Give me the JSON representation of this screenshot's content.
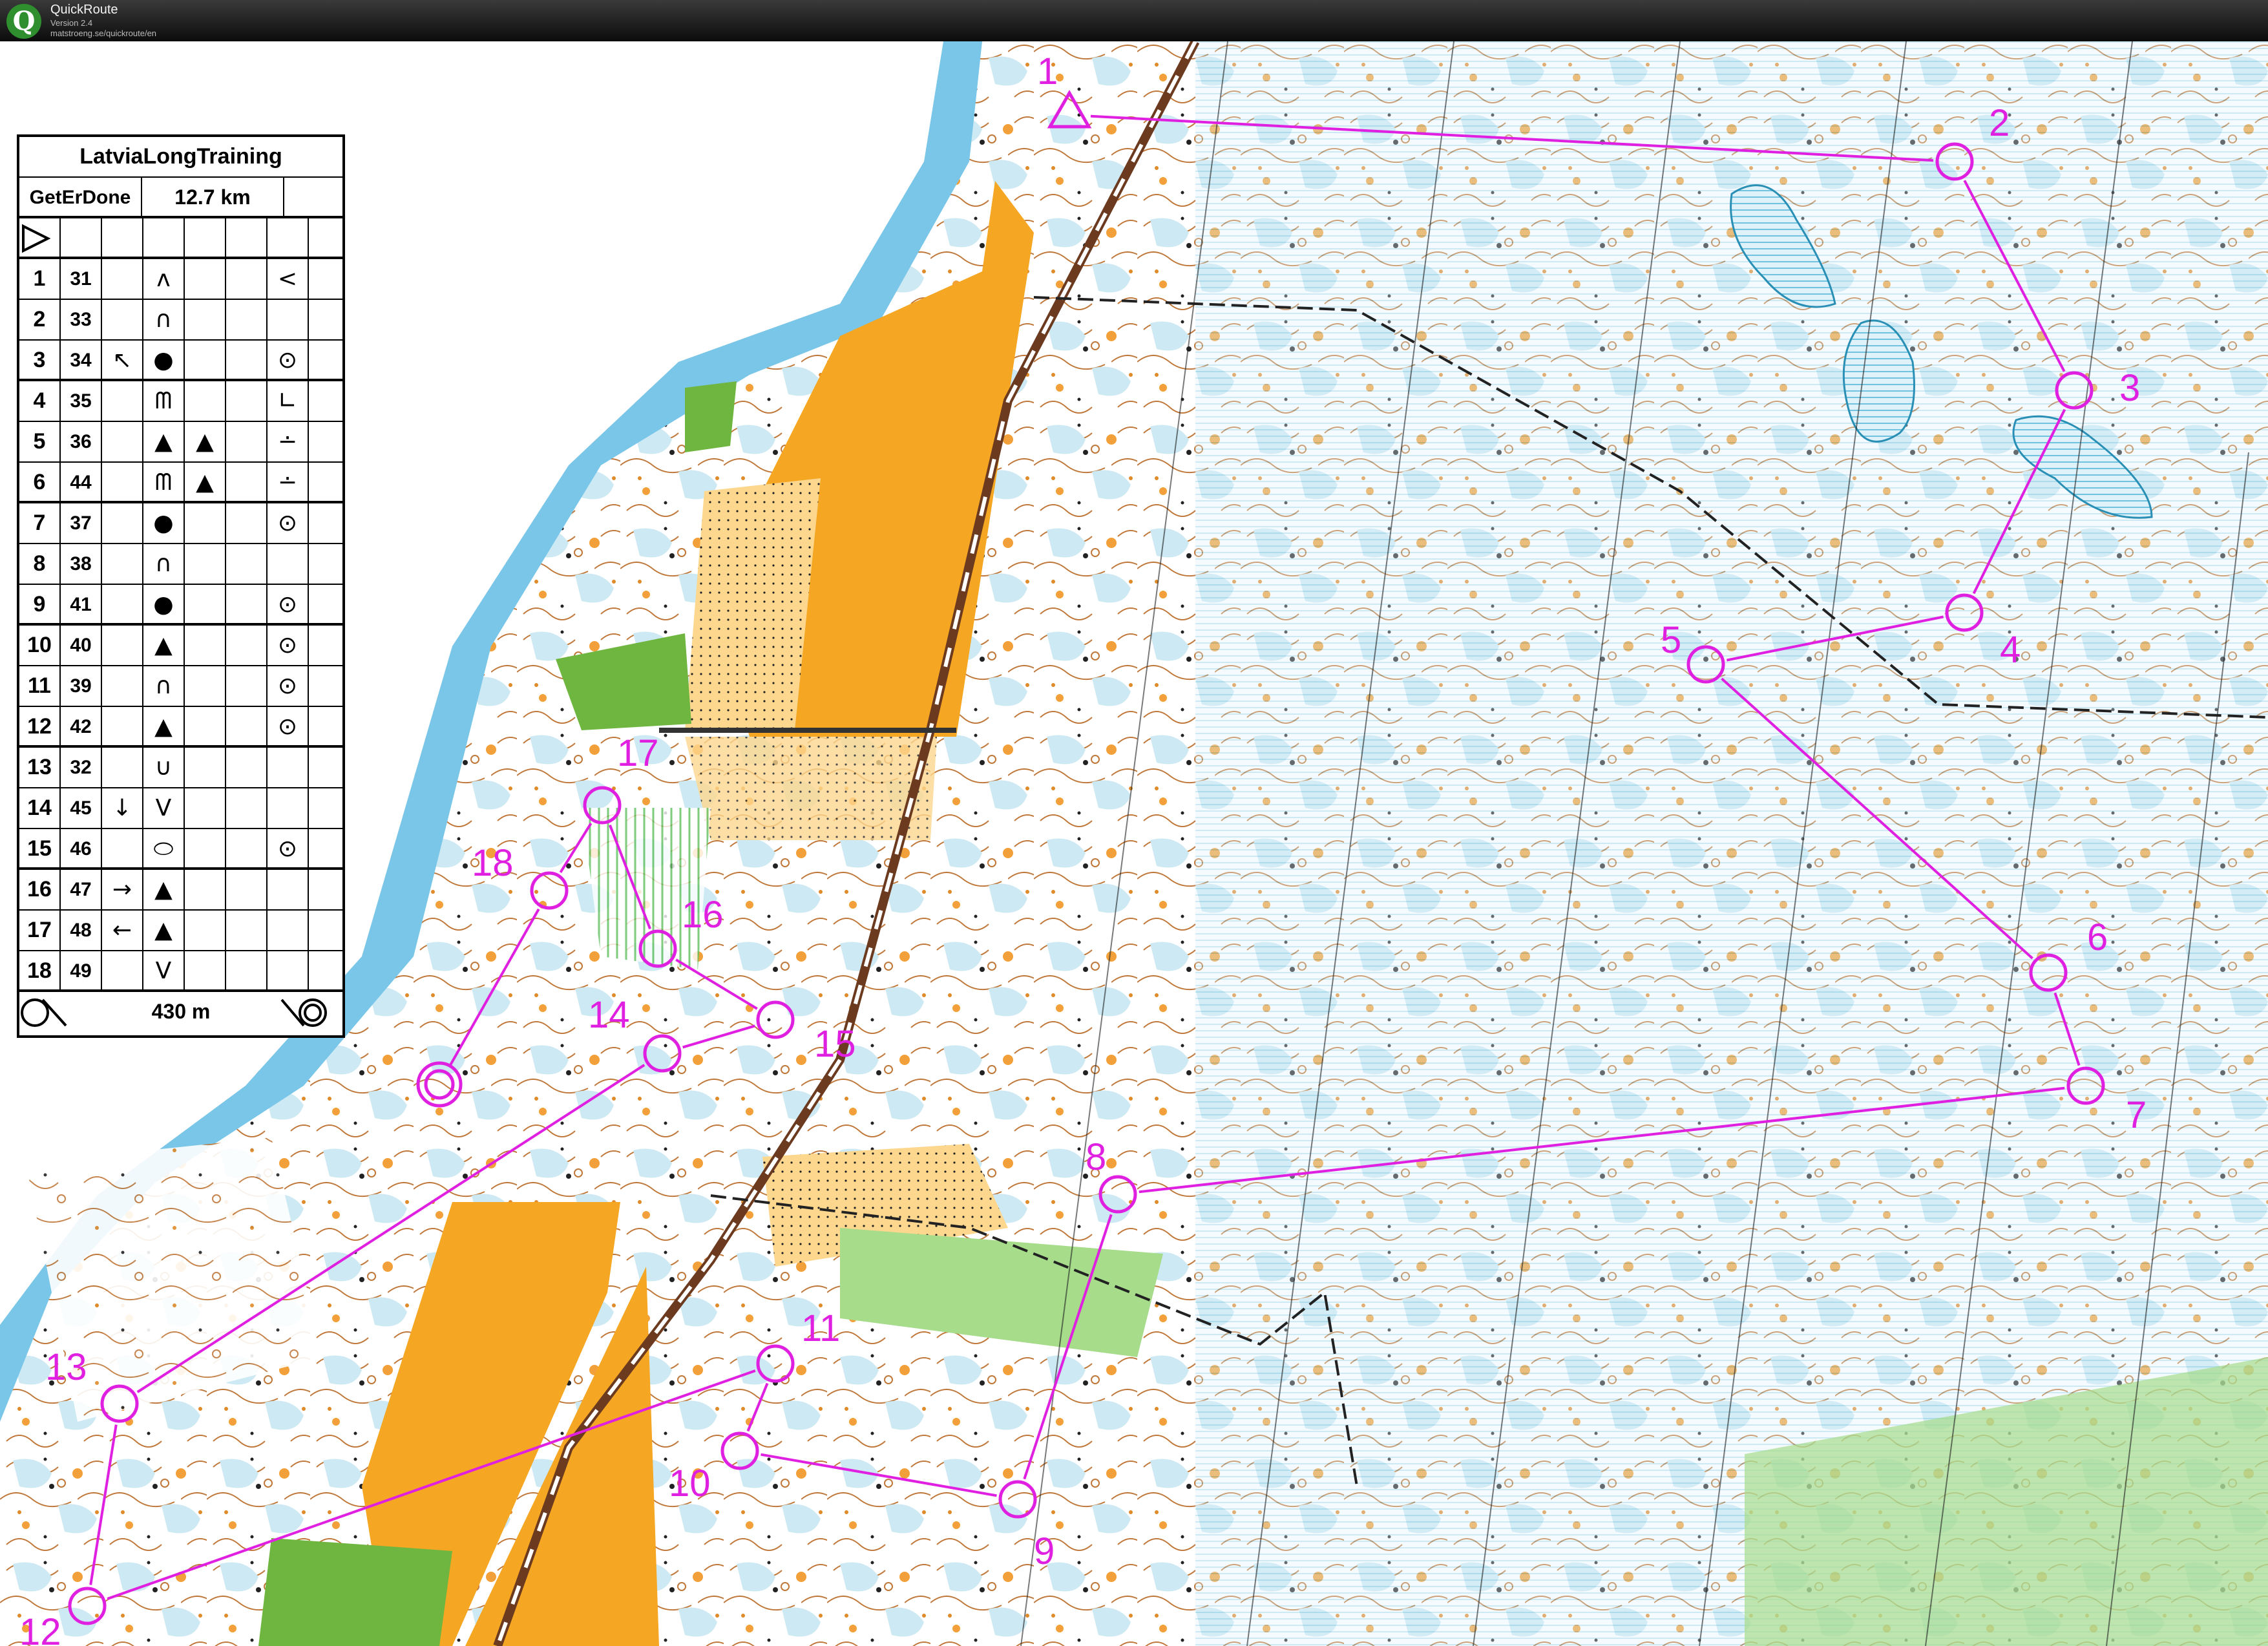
{
  "app": {
    "title": "QuickRoute",
    "version": "Version 2.4",
    "url": "matstroeng.se/quickroute/en",
    "logo_letter": "Q"
  },
  "description_sheet": {
    "event": "LatviaLongTraining",
    "course": "GetErDone",
    "length": "12.7 km",
    "start_symbol": "triangle-start",
    "controls": [
      {
        "n": "1",
        "code": "31",
        "dir": "",
        "feature": "ʌ",
        "detail": "",
        "extra": "<"
      },
      {
        "n": "2",
        "code": "33",
        "dir": "",
        "feature": "∩",
        "detail": "",
        "extra": ""
      },
      {
        "n": "3",
        "code": "34",
        "dir": "↖",
        "feature": "●",
        "detail": "",
        "extra": "⊙"
      },
      {
        "n": "4",
        "code": "35",
        "dir": "",
        "feature": "ᗰ",
        "detail": "",
        "extra": "∟"
      },
      {
        "n": "5",
        "code": "36",
        "dir": "",
        "feature": "▲",
        "detail": "▲",
        "extra": "∸"
      },
      {
        "n": "6",
        "code": "44",
        "dir": "",
        "feature": "ᗰ",
        "detail": "▲",
        "extra": "∸"
      },
      {
        "n": "7",
        "code": "37",
        "dir": "",
        "feature": "●",
        "detail": "",
        "extra": "⊙"
      },
      {
        "n": "8",
        "code": "38",
        "dir": "",
        "feature": "∩",
        "detail": "",
        "extra": ""
      },
      {
        "n": "9",
        "code": "41",
        "dir": "",
        "feature": "●",
        "detail": "",
        "extra": "⊙"
      },
      {
        "n": "10",
        "code": "40",
        "dir": "",
        "feature": "▲",
        "detail": "",
        "extra": "⊙"
      },
      {
        "n": "11",
        "code": "39",
        "dir": "",
        "feature": "∩",
        "detail": "",
        "extra": "⊙"
      },
      {
        "n": "12",
        "code": "42",
        "dir": "",
        "feature": "▲",
        "detail": "",
        "extra": "⊙"
      },
      {
        "n": "13",
        "code": "32",
        "dir": "",
        "feature": "∪",
        "detail": "",
        "extra": ""
      },
      {
        "n": "14",
        "code": "45",
        "dir": "↓",
        "feature": "V",
        "detail": "",
        "extra": ""
      },
      {
        "n": "15",
        "code": "46",
        "dir": "",
        "feature": "⬭",
        "detail": "",
        "extra": "⊙"
      },
      {
        "n": "16",
        "code": "47",
        "dir": "→",
        "feature": "▲",
        "detail": "",
        "extra": ""
      },
      {
        "n": "17",
        "code": "48",
        "dir": "←",
        "feature": "▲",
        "detail": "",
        "extra": ""
      },
      {
        "n": "18",
        "code": "49",
        "dir": "",
        "feature": "V",
        "detail": "",
        "extra": ""
      }
    ],
    "finish_distance": "430 m"
  },
  "course_controls": [
    {
      "label": "1"
    },
    {
      "label": "2"
    },
    {
      "label": "3"
    },
    {
      "label": "4"
    },
    {
      "label": "5"
    },
    {
      "label": "6"
    },
    {
      "label": "7"
    },
    {
      "label": "8"
    },
    {
      "label": "9"
    },
    {
      "label": "10"
    },
    {
      "label": "11"
    },
    {
      "label": "12"
    },
    {
      "label": "13"
    },
    {
      "label": "14"
    },
    {
      "label": "15"
    },
    {
      "label": "16"
    },
    {
      "label": "17"
    },
    {
      "label": "18"
    }
  ],
  "colors": {
    "course": "#e020e0",
    "water": "#7ec8e8",
    "open_land": "#f5a623",
    "rough_open": "#fbd08a",
    "green": "#8fd36a",
    "marsh": "#4fb7d6",
    "contour": "#b5651d"
  }
}
